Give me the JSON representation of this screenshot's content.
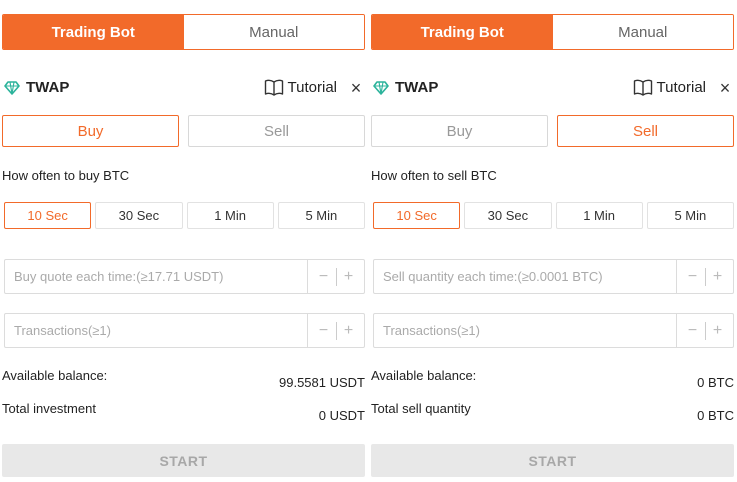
{
  "panels": [
    {
      "mode_tabs": {
        "active": "Trading Bot",
        "inactive": "Manual"
      },
      "title": "TWAP",
      "tutorial": "Tutorial",
      "close": "×",
      "side_buttons": [
        "Buy",
        "Sell"
      ],
      "active_side": "Buy",
      "frequency_label": "How often to buy BTC",
      "frequencies": [
        "10 Sec",
        "30 Sec",
        "1 Min",
        "5 Min"
      ],
      "active_frequency": "10 Sec",
      "amount_placeholder": "Buy quote each time:(≥17.71 USDT)",
      "transactions_placeholder": "Transactions(≥1)",
      "stepper": {
        "minus": "−",
        "plus": "+"
      },
      "info": [
        {
          "label": "Available balance:",
          "value": "99.5581 USDT"
        },
        {
          "label": "Total investment",
          "value": "0 USDT"
        }
      ],
      "start_label": "START"
    },
    {
      "mode_tabs": {
        "active": "Trading Bot",
        "inactive": "Manual"
      },
      "title": "TWAP",
      "tutorial": "Tutorial",
      "close": "×",
      "side_buttons": [
        "Buy",
        "Sell"
      ],
      "active_side": "Sell",
      "frequency_label": "How often to sell BTC",
      "frequencies": [
        "10 Sec",
        "30 Sec",
        "1 Min",
        "5 Min"
      ],
      "active_frequency": "10 Sec",
      "amount_placeholder": "Sell quantity each time:(≥0.0001 BTC)",
      "transactions_placeholder": "Transactions(≥1)",
      "stepper": {
        "minus": "−",
        "plus": "+"
      },
      "info": [
        {
          "label": "Available balance:",
          "value": "0 BTC"
        },
        {
          "label": "Total sell quantity",
          "value": "0 BTC"
        }
      ],
      "start_label": "START"
    }
  ],
  "colors": {
    "accent": "#f26a2a",
    "twap_icon": "#2bb39b",
    "start_bg": "#e8e8e8"
  },
  "icons": {
    "twap": "diamond-icon",
    "tutorial": "book-icon",
    "close": "close-icon"
  }
}
